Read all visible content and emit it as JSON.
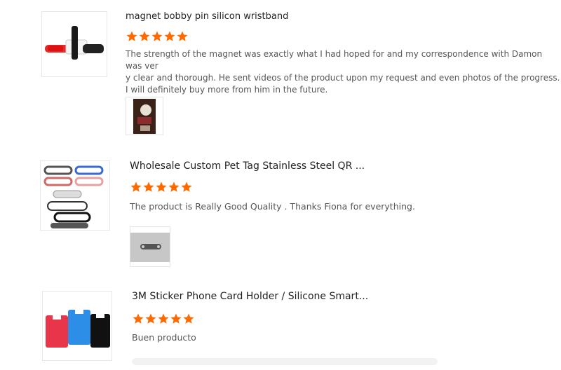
{
  "reviews": [
    {
      "title": "magnet bobby pin silicon wristband",
      "rating": 5,
      "text_lines": [
        "The strength of the magnet was exactly what I had hoped for and my correspondence with Damon was ver",
        "y clear and thorough. He sent videos of the product upon my request and even photos of the progress.",
        "I will definitely buy more from him in the future."
      ]
    },
    {
      "title": "Wholesale Custom Pet Tag Stainless Steel QR ...",
      "rating": 5,
      "text_lines": [
        "The product is Really Good Quality . Thanks Fiona for everything."
      ]
    },
    {
      "title": "3M Sticker Phone Card Holder / Silicone Smart...",
      "rating": 5,
      "text_lines": [
        "Buen producto"
      ]
    }
  ],
  "colors": {
    "star": "#ff6a00",
    "title": "#222222",
    "text": "#555555"
  },
  "icons": {
    "rating": "star-icon"
  }
}
